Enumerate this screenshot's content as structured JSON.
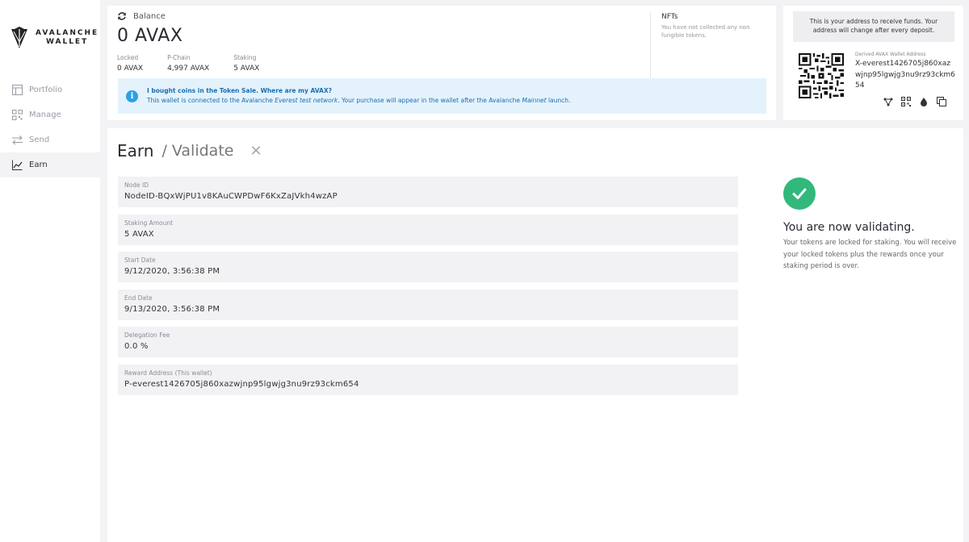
{
  "logo": {
    "line1": "AVALANCHE",
    "line2": "WALLET"
  },
  "sidebar": {
    "items": [
      {
        "label": "Portfolio",
        "icon": "portfolio-icon"
      },
      {
        "label": "Manage",
        "icon": "manage-icon"
      },
      {
        "label": "Send",
        "icon": "send-icon"
      },
      {
        "label": "Earn",
        "icon": "earn-icon",
        "active": true
      }
    ]
  },
  "balance": {
    "header": "Balance",
    "amount": "0 AVAX",
    "locked_label": "Locked",
    "locked_value": "0 AVAX",
    "pchain_label": "P-Chain",
    "pchain_value": "4,997 AVAX",
    "staking_label": "Staking",
    "staking_value": "5 AVAX"
  },
  "nfts": {
    "title": "NFTs",
    "desc": "You have not collected any non fungible tokens."
  },
  "banner": {
    "title": "I bought coins in the Token Sale. Where are my AVAX?",
    "body_prefix": "This wallet is connected to the Avalanche ",
    "body_em1": "Everest test network",
    "body_mid": ". Your purchase will appear in the wallet after the Avalanche ",
    "body_em2": "Mainnet",
    "body_suffix": " launch."
  },
  "address": {
    "note": "This is your address to receive funds. Your address will change after every deposit.",
    "label": "Derived AVAX Wallet Address",
    "value": "X-everest1426705j860xazwjnp95lgwjg3nu9rz93ckm654"
  },
  "earn": {
    "title": "Earn",
    "subtitle": "/ Validate",
    "close": "✕"
  },
  "fields": [
    {
      "label": "Node ID",
      "value": "NodeID-BQxWjPU1v8KAuCWPDwF6KxZaJVkh4wzAP"
    },
    {
      "label": "Staking Amount",
      "value": "5 AVAX"
    },
    {
      "label": "Start Date",
      "value": "9/12/2020, 3:56:38 PM"
    },
    {
      "label": "End Date",
      "value": "9/13/2020, 3:56:38 PM"
    },
    {
      "label": "Delegation Fee",
      "value": "0.0 %"
    },
    {
      "label": "Reward Address (This wallet)",
      "value": "P-everest1426705j860xazwjnp95lgwjg3nu9rz93ckm654"
    }
  ],
  "success": {
    "title": "You are now validating.",
    "desc": "Your tokens are locked for staking. You will receive your locked tokens plus the rewards once your staking period is over."
  },
  "colors": {
    "accent": "#2d9fe6",
    "success": "#32b87a",
    "banner_bg": "#e4f2fc"
  }
}
